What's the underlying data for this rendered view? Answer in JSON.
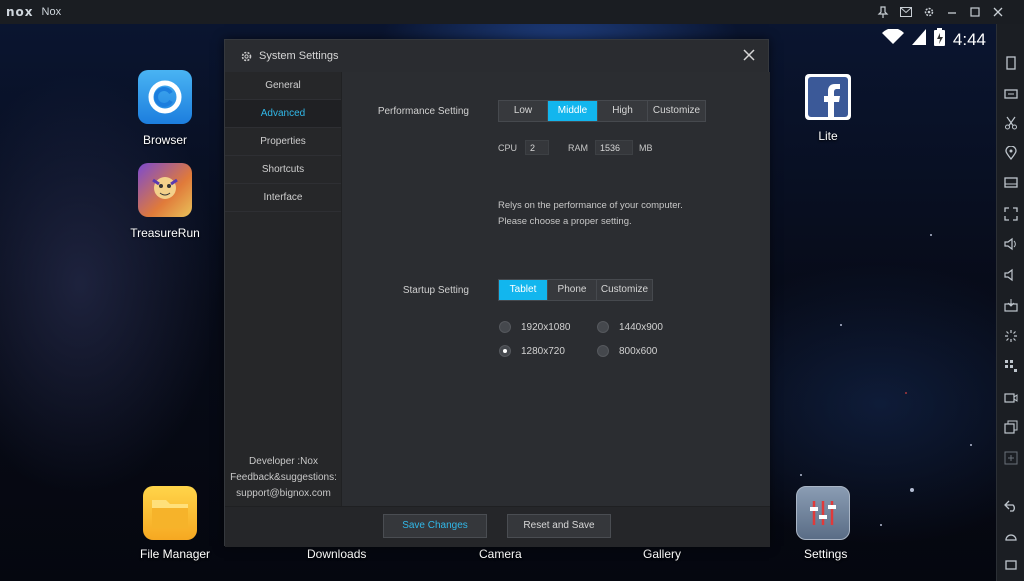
{
  "titlebar": {
    "logo": "nox",
    "title": "Nox"
  },
  "status": {
    "time": "4:44"
  },
  "apps": {
    "browser": "Browser",
    "treasure": "TreasureRun",
    "lite": "Lite",
    "file_manager": "File Manager",
    "downloads": "Downloads",
    "camera": "Camera",
    "gallery": "Gallery",
    "settings": "Settings"
  },
  "dialog": {
    "title": "System Settings",
    "nav": [
      "General",
      "Advanced",
      "Properties",
      "Shortcuts",
      "Interface"
    ],
    "active_nav": "Advanced",
    "developer": "Developer :Nox",
    "feedback": "Feedback&suggestions:",
    "email": "support@bignox.com",
    "performance": {
      "label": "Performance Setting",
      "options": [
        "Low",
        "Middle",
        "High",
        "Customize"
      ],
      "selected": "Middle",
      "cpu_label": "CPU",
      "cpu_value": "2",
      "ram_label": "RAM",
      "ram_value": "1536",
      "ram_unit": "MB",
      "hint_line1": "Relys on the performance of your computer.",
      "hint_line2": "Please choose a proper setting."
    },
    "startup": {
      "label": "Startup Setting",
      "options": [
        "Tablet",
        "Phone",
        "Customize"
      ],
      "selected": "Tablet",
      "resolutions": [
        "1920x1080",
        "1440x900",
        "1280x720",
        "800x600"
      ],
      "selected_resolution": "1280x720"
    },
    "buttons": {
      "save": "Save Changes",
      "reset": "Reset and Save"
    }
  },
  "colors": {
    "accent": "#12b6ee",
    "active_nav_text": "#31b8e8",
    "panel": "#2b2d31"
  },
  "icons": [
    "gear-icon",
    "close-icon",
    "wifi-icon",
    "signal-icon",
    "battery-icon"
  ]
}
